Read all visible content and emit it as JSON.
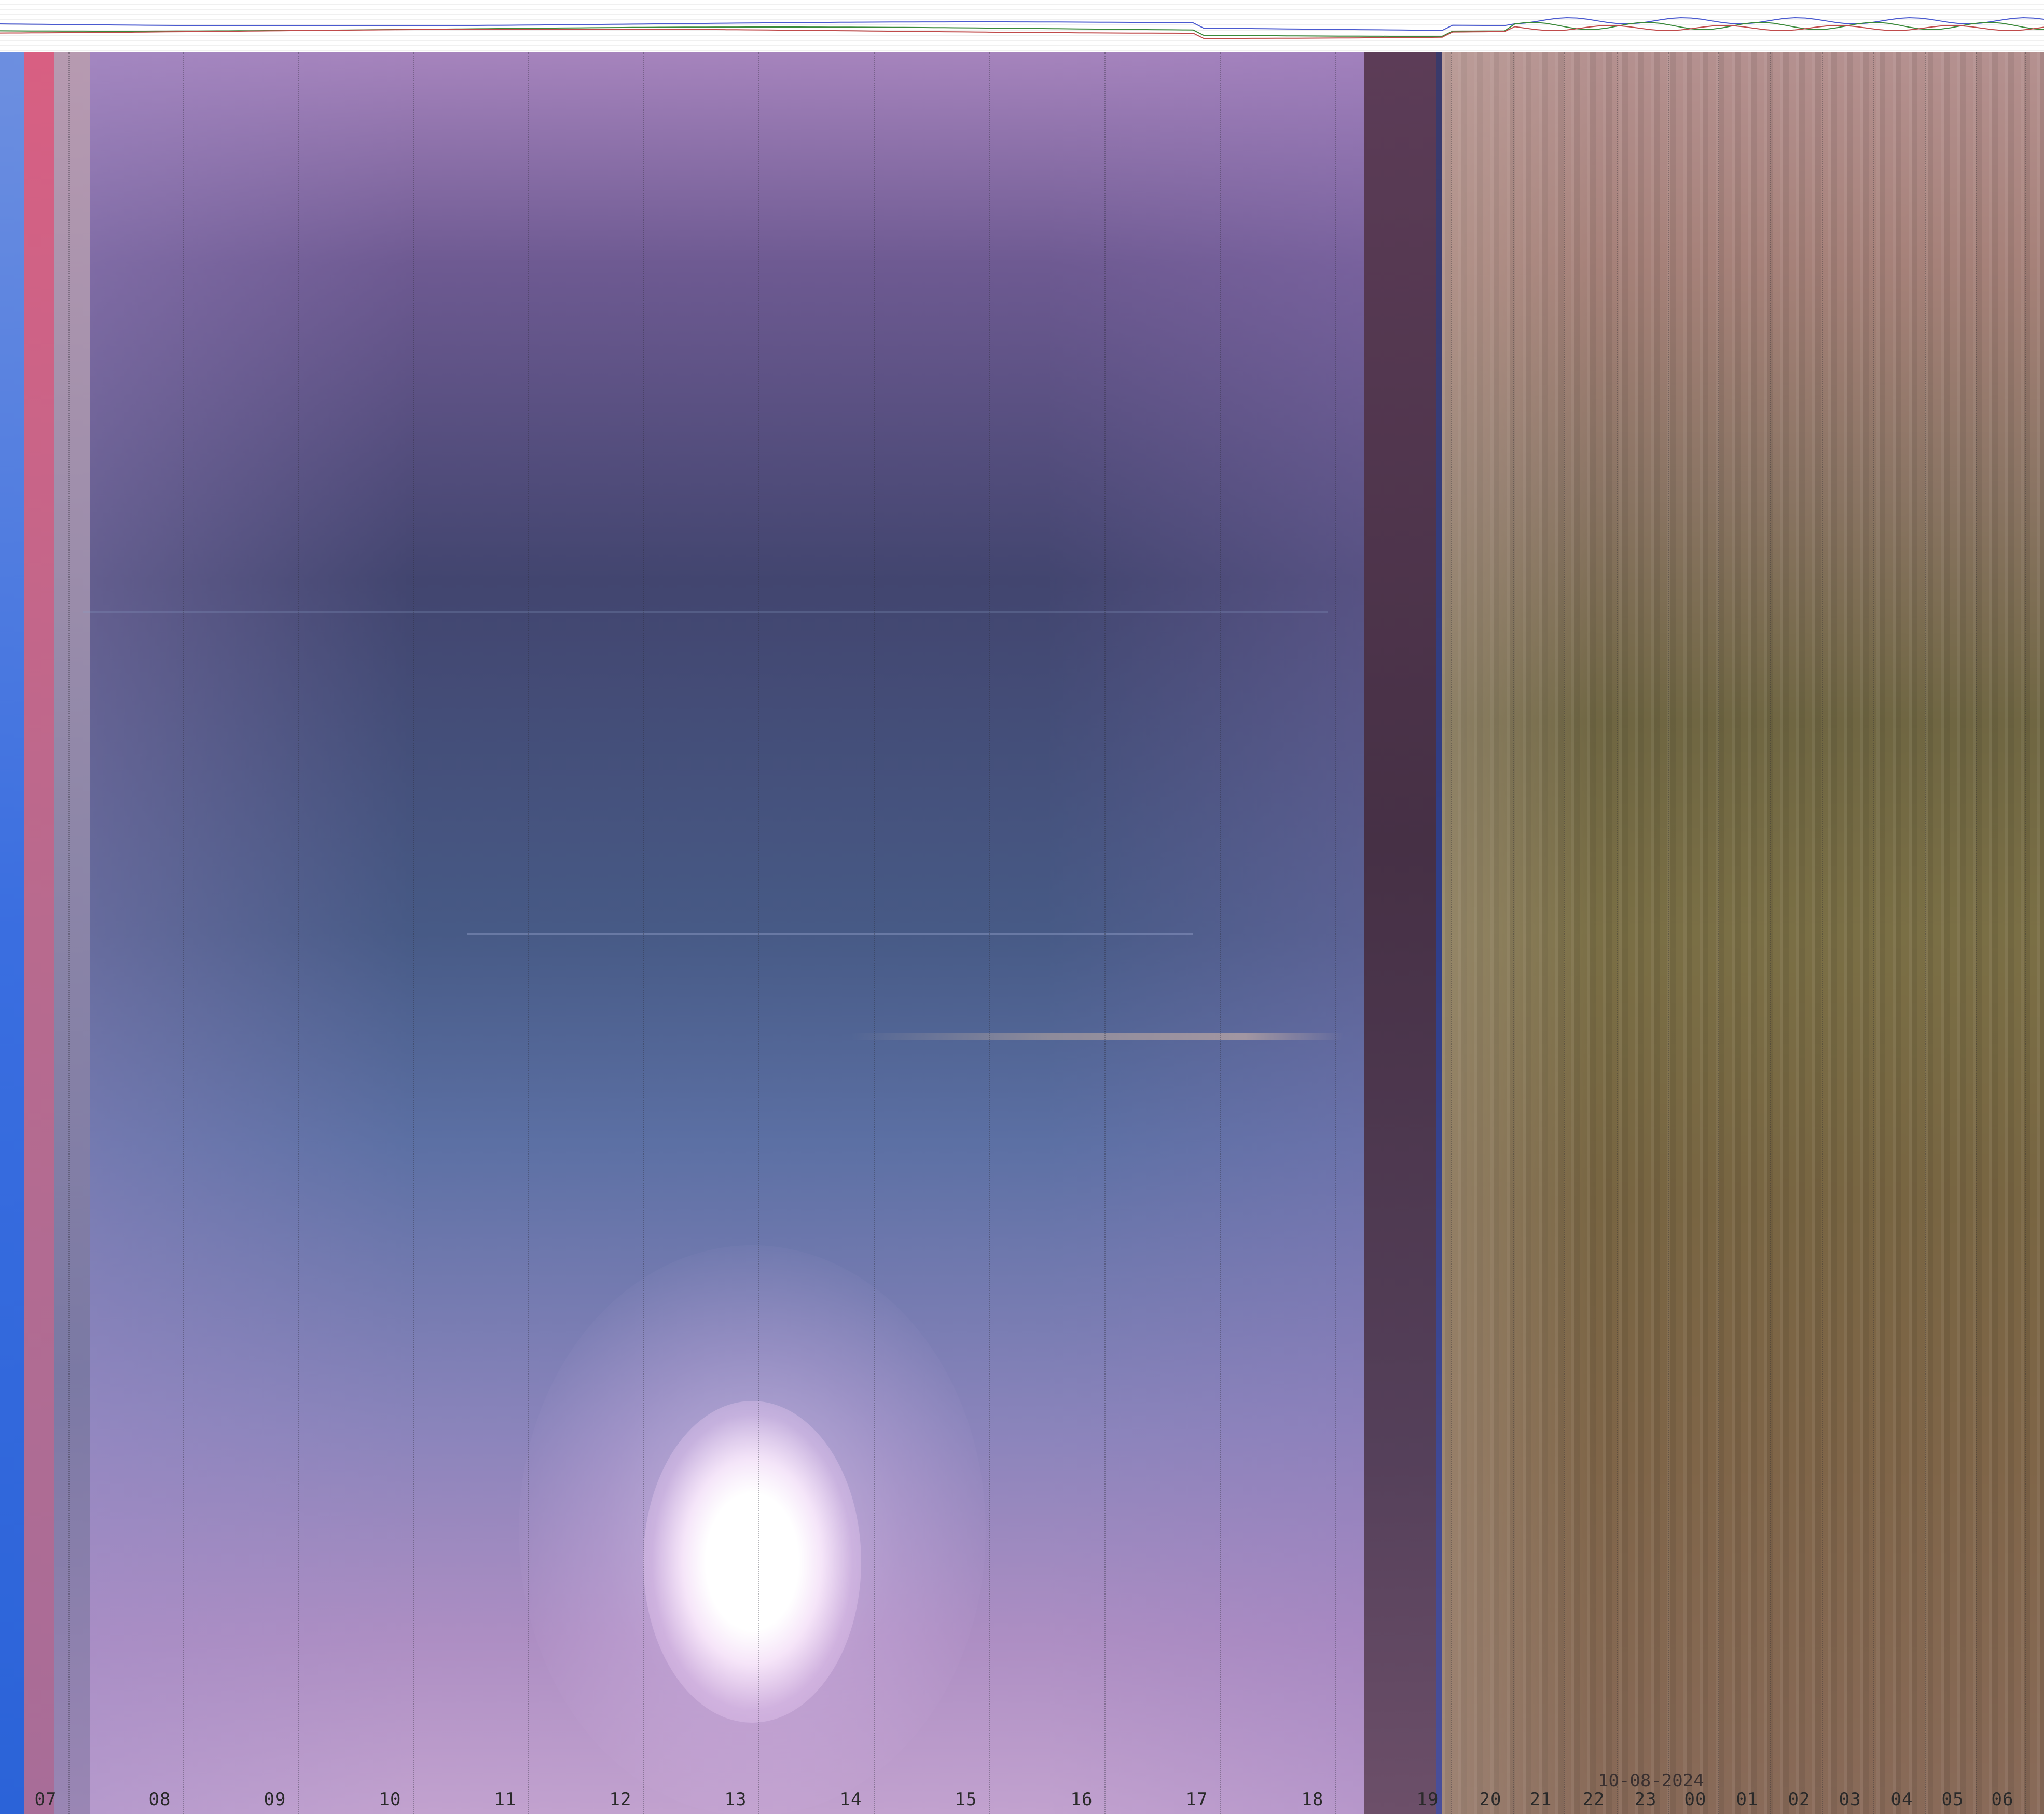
{
  "image": {
    "kind": "all-sky camera keogram",
    "date_label": "10-08-2024",
    "hour_labels": [
      "07",
      "08",
      "09",
      "10",
      "11",
      "12",
      "13",
      "14",
      "15",
      "16",
      "17",
      "18",
      "19",
      "20",
      "21",
      "22",
      "23",
      "00",
      "01",
      "02",
      "03",
      "04",
      "05",
      "06"
    ]
  },
  "colors": {
    "day_sky": "#475a86",
    "dusk": "#463045",
    "night": "#786542",
    "left_edge_blue": "#3a6ee0",
    "sun": "#ffffff",
    "plot_line_blue": "#4a5ad0",
    "plot_line_green": "#3a8a3a",
    "plot_line_red": "#c04a4a"
  }
}
